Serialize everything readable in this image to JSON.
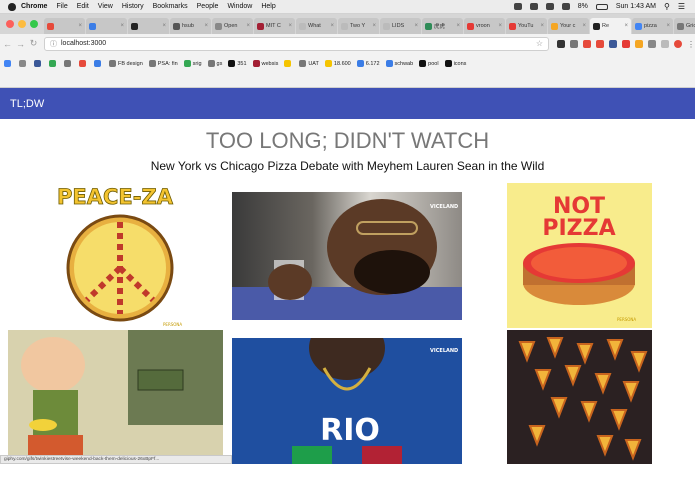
{
  "menubar": {
    "items": [
      "Chrome",
      "File",
      "Edit",
      "View",
      "History",
      "Bookmarks",
      "People",
      "Window",
      "Help"
    ],
    "battery": "8%",
    "clock": "Sun 1:43 AM"
  },
  "tabs": [
    {
      "label": "",
      "color": "#e64a3b"
    },
    {
      "label": "",
      "color": "#3b7de6"
    },
    {
      "label": "",
      "color": "#222222"
    },
    {
      "label": "hsub",
      "color": "#555555"
    },
    {
      "label": "Open",
      "color": "#888888"
    },
    {
      "label": "MIT C",
      "color": "#a31f34"
    },
    {
      "label": "What",
      "color": "#bbbbbb"
    },
    {
      "label": "Two Y",
      "color": "#bbbbbb"
    },
    {
      "label": "LIDS",
      "color": "#bbbbbb"
    },
    {
      "label": "虎虎",
      "color": "#2e8b57"
    },
    {
      "label": "vroon",
      "color": "#e53935"
    },
    {
      "label": "YouTu",
      "color": "#e53935"
    },
    {
      "label": "Your c",
      "color": "#f5a623"
    },
    {
      "label": "Re",
      "color": "#222222",
      "active": true
    },
    {
      "label": "pizza",
      "color": "#4285f4"
    },
    {
      "label": "Grid l",
      "color": "#777777"
    }
  ],
  "url": {
    "value": "localhost:3000"
  },
  "bookmarks": [
    {
      "label": "",
      "color": "#4285f4"
    },
    {
      "label": "",
      "color": "#888888"
    },
    {
      "label": "",
      "color": "#3b5998"
    },
    {
      "label": "",
      "color": "#34a853"
    },
    {
      "label": "",
      "color": "#777777"
    },
    {
      "label": "",
      "color": "#e64a3b"
    },
    {
      "label": "",
      "color": "#3b7de6"
    },
    {
      "label": "FB design",
      "color": "#777777"
    },
    {
      "label": "PSA: fin",
      "color": "#777777"
    },
    {
      "label": "srig",
      "color": "#34a853"
    },
    {
      "label": "gs",
      "color": "#777777"
    },
    {
      "label": "351",
      "color": "#111111"
    },
    {
      "label": "websis",
      "color": "#a31f34"
    },
    {
      "label": "",
      "color": "#f5c400"
    },
    {
      "label": "UAT",
      "color": "#777777"
    },
    {
      "label": "18.600",
      "color": "#f5c400"
    },
    {
      "label": "6.172",
      "color": "#3b7de6"
    },
    {
      "label": "schwab",
      "color": "#3b7de6"
    },
    {
      "label": "pool",
      "color": "#111111"
    },
    {
      "label": "icons",
      "color": "#111111"
    }
  ],
  "app": {
    "brand": "TL;DW",
    "title": "TOO LONG; DIDN'T WATCH",
    "subtitle": "New York vs Chicago Pizza Debate with Meyhem Lauren Sean in the Wild"
  },
  "gifs": {
    "peaceza_text": "PEACE-ZA",
    "notpizza_line1": "NOT",
    "notpizza_line2": "PIZZA",
    "rio_text": "RIO",
    "watermark": "VICELAND"
  },
  "status_url": "giphy.com/gifs/twinkiestreetvise-weekend-back-them-delicious-26xBpFf..."
}
